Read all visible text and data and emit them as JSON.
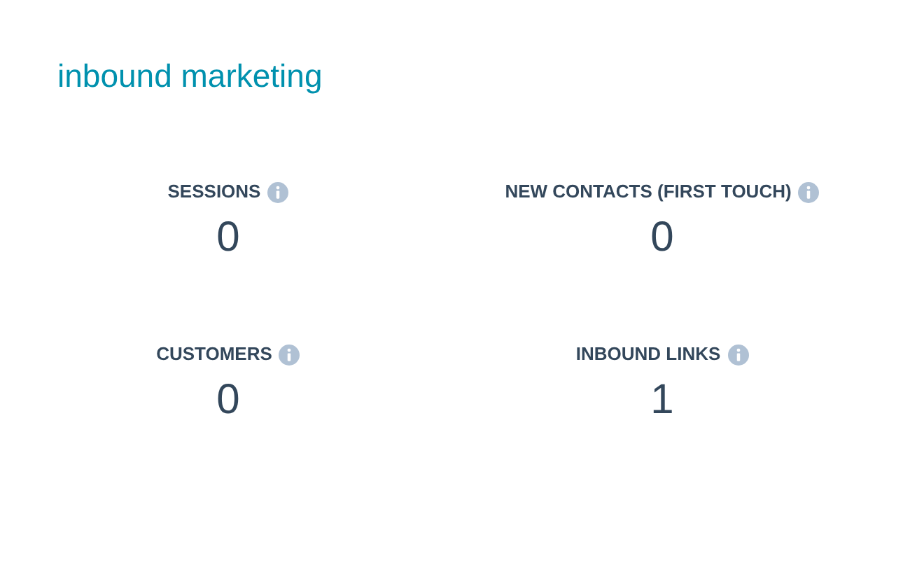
{
  "title": "inbound marketing",
  "metrics": [
    {
      "label": "SESSIONS",
      "value": "0"
    },
    {
      "label": "NEW CONTACTS (FIRST TOUCH)",
      "value": "0"
    },
    {
      "label": "CUSTOMERS",
      "value": "0"
    },
    {
      "label": "INBOUND LINKS",
      "value": "1"
    }
  ]
}
